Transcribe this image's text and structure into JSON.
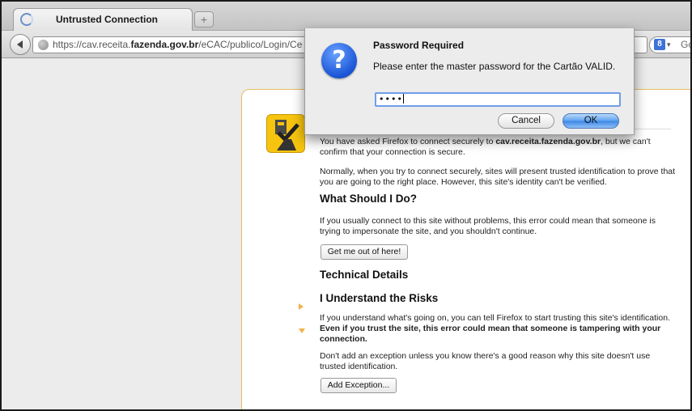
{
  "tab": {
    "title": "Untrusted Connection",
    "newtab_glyph": "+"
  },
  "urlbar": {
    "prefix": "https://cav.receita.",
    "host": "fazenda.gov.br",
    "suffix": "/eCAC/publico/Login/Ce"
  },
  "searchbar": {
    "engine_glyph": "8",
    "engine_chevron": "▾",
    "text": "Goog"
  },
  "error_page": {
    "p1_hidden_head": "You have asked Firefox to connect securely to ",
    "p1_host": "cav.receita.fazenda.gov.br",
    "p1_tail": ", but we can't confirm that your connection is secure.",
    "p2": "Normally, when you try to connect securely, sites will present trusted identification to prove that you are going to the right place. However, this site's identity can't be verified.",
    "h_what": "What Should I Do?",
    "p3": "If you usually connect to this site without problems, this error could mean that someone is trying to impersonate the site, and you shouldn't continue.",
    "get_out_label": "Get me out of here!",
    "h_technical": "Technical Details",
    "h_risks": "I Understand the Risks",
    "p4_plain": "If you understand what's going on, you can tell Firefox to start trusting this site's identification. ",
    "p4_bold": "Even if you trust the site, this error could mean that someone is tampering with your connection.",
    "p5": "Don't add an exception unless you know there's a good reason why this site doesn't use trusted identification.",
    "add_exception_label": "Add Exception..."
  },
  "dialog": {
    "title": "Password Required",
    "message": "Please enter the master password for the Cartão VALID.",
    "icon_glyph": "?",
    "password_value": "••••",
    "cancel_label": "Cancel",
    "ok_label": "OK"
  },
  "colors": {
    "accent": "#3b86e6",
    "errbox_border": "#e9bd5e",
    "cert_icon": "#f6c40f"
  }
}
